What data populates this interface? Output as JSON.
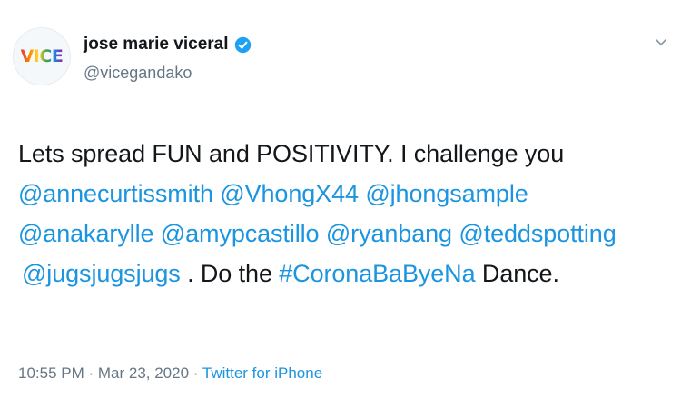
{
  "user": {
    "display_name": "jose marie viceral",
    "handle": "@vicegandako",
    "avatar_logo_text": "VICE",
    "verified": true,
    "verified_color": "#1da1f2"
  },
  "menu_icon": "chevron-down-icon",
  "tweet": {
    "line1": "Lets spread FUN and POSITIVITY.  I challenge you",
    "line2": {
      "m1": "@annecurtissmith",
      "m2": "@VhongX44",
      "m3": "@jhongsample"
    },
    "line3": {
      "m1": "@anakarylle",
      "m2": "@amypcastillo",
      "m3": "@ryanbang",
      "m4": "@teddspotting"
    },
    "line4": {
      "m1": "@jugsjugsjugs",
      "text_a": " . Do the ",
      "hashtag": "#CoronaBaByeNa",
      "text_b": " Dance."
    }
  },
  "meta": {
    "time": "10:55 PM",
    "separator": " · ",
    "date": "Mar 23, 2020",
    "source": "Twitter for iPhone"
  },
  "colors": {
    "link": "#1b95e0",
    "text": "#14171a",
    "secondary": "#657786"
  }
}
